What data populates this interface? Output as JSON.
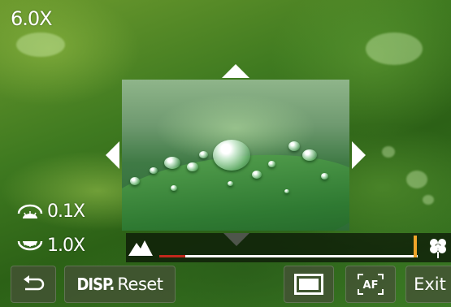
{
  "zoom": {
    "current": "6.0X"
  },
  "magnification": {
    "top": {
      "icon": "reduce-magnification-icon",
      "value": "0.1X"
    },
    "bottom": {
      "icon": "magnification-icon",
      "value": "1.0X"
    }
  },
  "focus_range": {
    "near_icon": "mountain-icon",
    "far_icon": "macro-flower-icon",
    "filled_fraction": 0.1,
    "marker_fraction": 0.99,
    "fill_color": "#c0281c",
    "marker_color": "#f0a52a"
  },
  "arrows": [
    "up",
    "down",
    "left",
    "right"
  ],
  "buttons": {
    "back": {
      "icon": "return-icon"
    },
    "reset": {
      "prefix": "DISP.",
      "label": "Reset"
    },
    "frame": {
      "icon": "frame-size-icon"
    },
    "af": {
      "icon": "af-area-icon",
      "label": "AF"
    },
    "exit": {
      "label": "Exit"
    }
  }
}
